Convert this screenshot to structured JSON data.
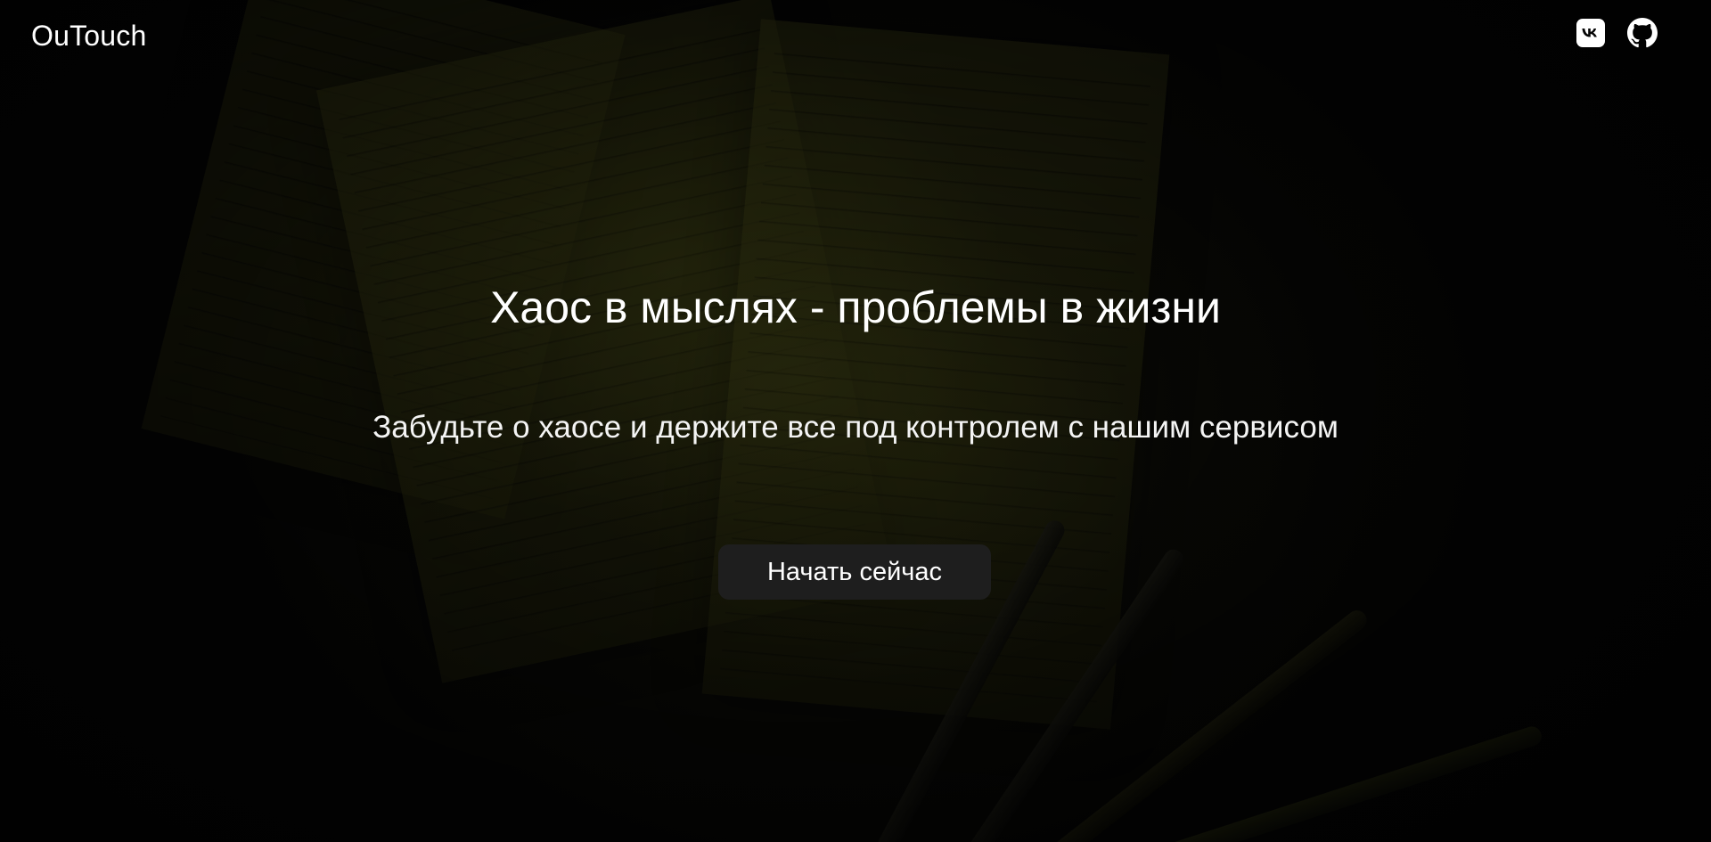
{
  "header": {
    "logo": "OuTouch",
    "social": [
      {
        "name": "vk",
        "icon": "vk-icon"
      },
      {
        "name": "github",
        "icon": "github-icon"
      }
    ]
  },
  "hero": {
    "headline": "Хаос в мыслях - проблемы в жизни",
    "subheadline": "Забудьте о хаосе и держите все под контролем с нашим сервисом",
    "cta_label": "Начать сейчас",
    "background_image": "dark photo of handwritten notes and pens"
  },
  "colors": {
    "text": "#ffffff",
    "button_bg": "#1e1e1e",
    "page_bg": "#050505"
  }
}
